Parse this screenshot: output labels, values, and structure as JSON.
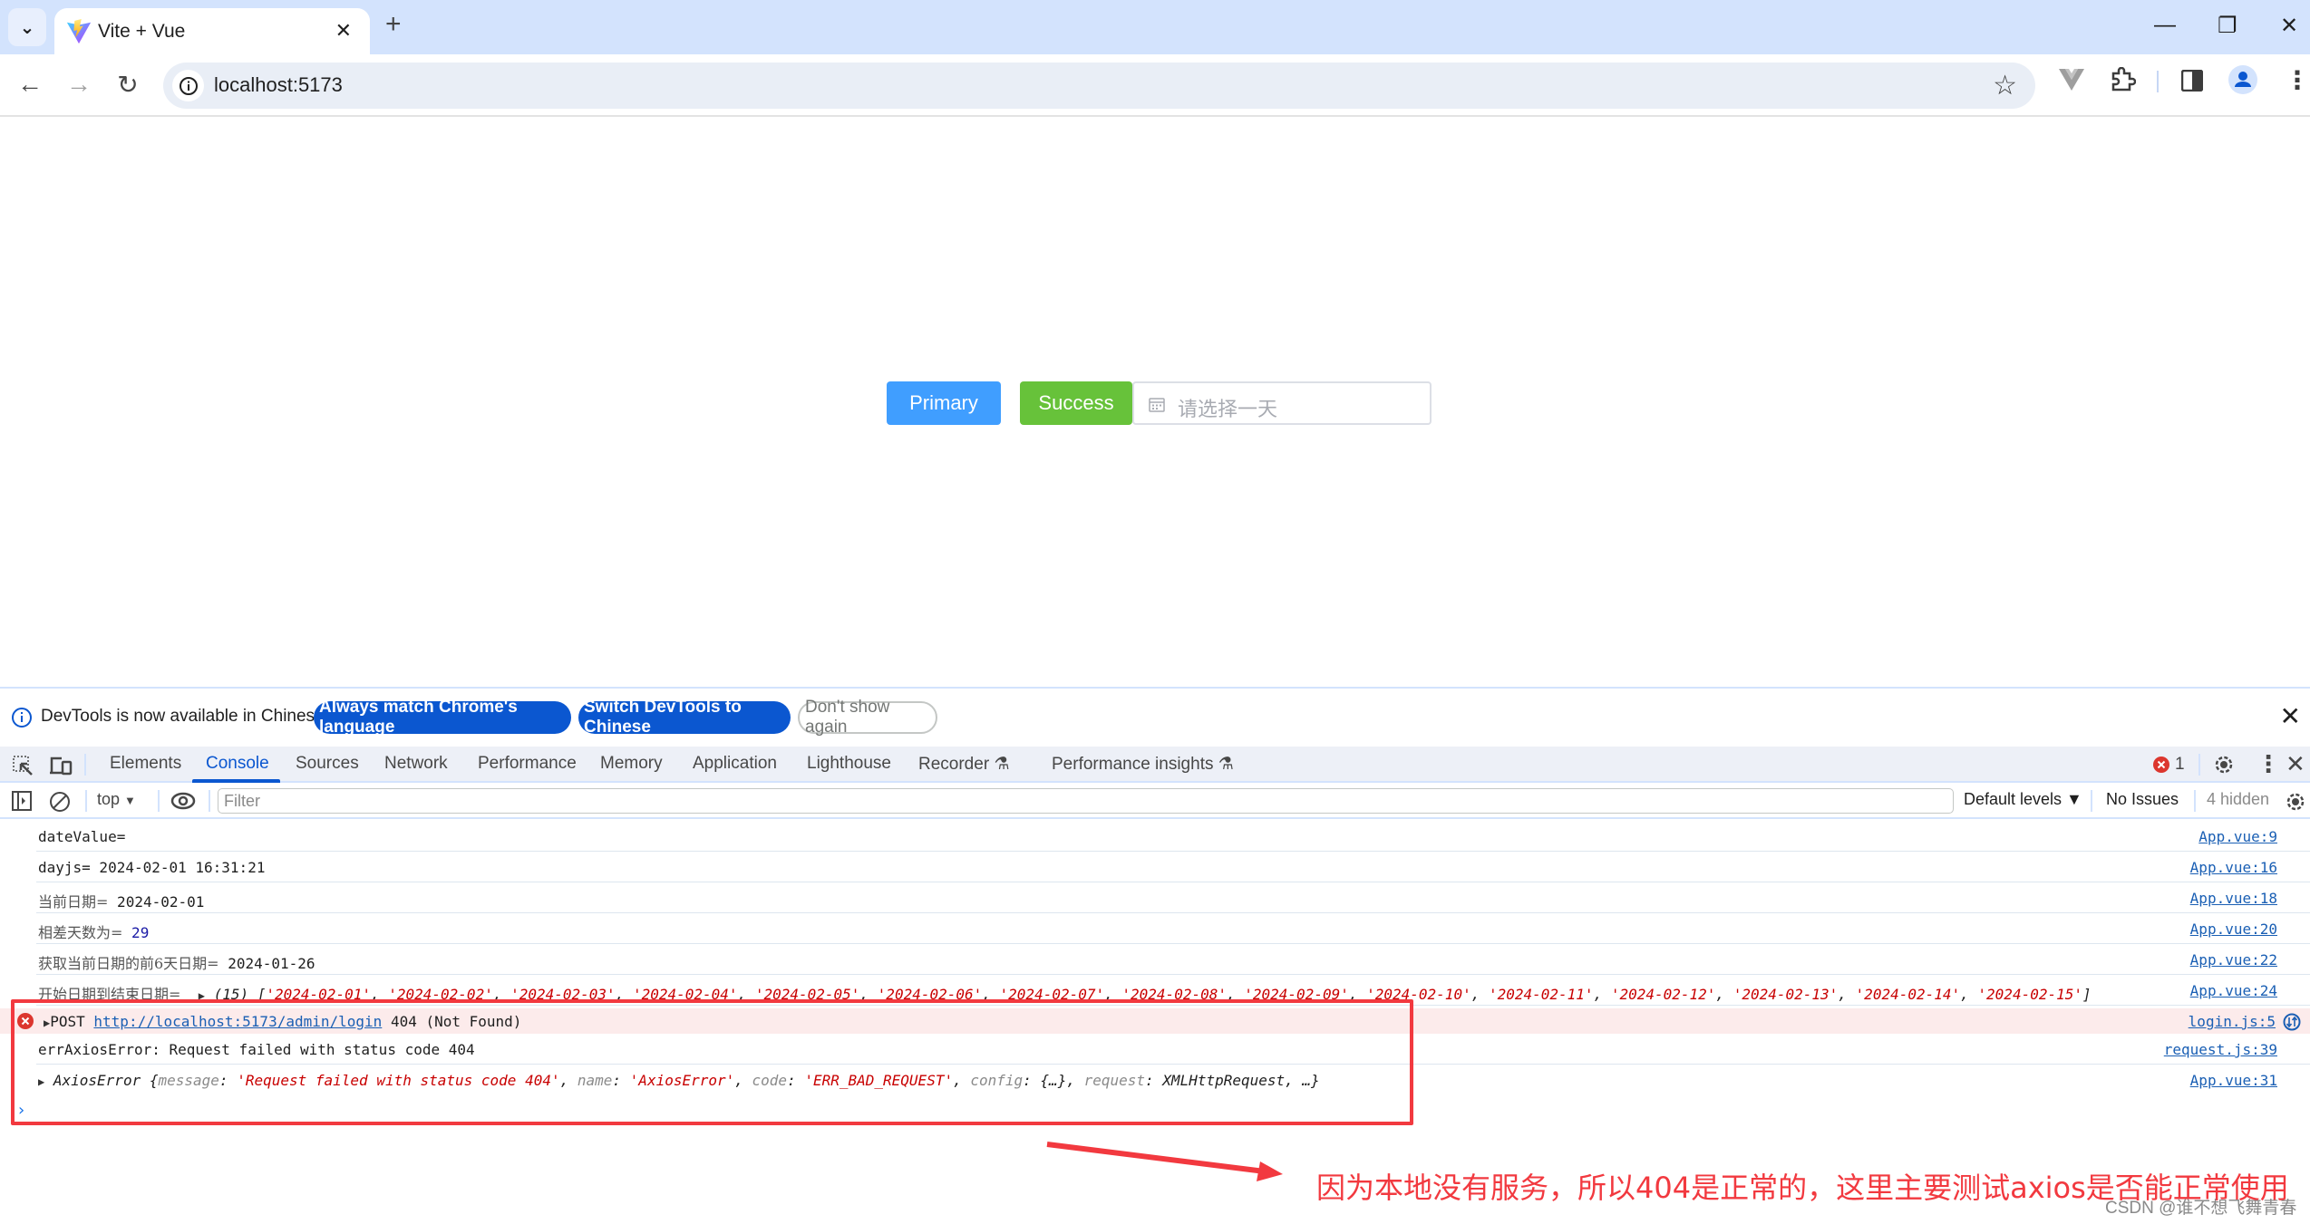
{
  "browser": {
    "tab_title": "Vite + Vue",
    "url": "localhost:5173",
    "icons": {
      "tab_search": "chevron-down-icon",
      "favicon": "vite-logo-icon",
      "close_tab": "close-icon",
      "new_tab": "plus-icon",
      "back": "arrow-left-icon",
      "forward": "arrow-right-icon",
      "reload": "reload-icon",
      "site_info": "info-icon",
      "bookmark": "star-icon",
      "vue_devtools": "vue-logo-icon",
      "extensions": "puzzle-icon",
      "side_panel": "side-panel-icon",
      "profile": "profile-icon",
      "menu": "kebab-menu-icon"
    },
    "glyphs": {
      "tab_search": "⌄",
      "close_tab": "✕",
      "new_tab": "+",
      "back": "←",
      "forward": "→",
      "reload": "↻",
      "bookmark": "☆",
      "minimize": "—",
      "maximize": "❐",
      "close_window": "✕",
      "menu": "⋮"
    }
  },
  "page": {
    "primary_button": "Primary",
    "success_button": "Success",
    "date_placeholder": "请选择一天",
    "colors": {
      "primary": "#409eff",
      "success": "#67c23a"
    }
  },
  "devtools": {
    "infobar": {
      "message": "DevTools is now available in Chinese!",
      "buttons": [
        "Always match Chrome's language",
        "Switch DevTools to Chinese",
        "Don't show again"
      ],
      "close_glyph": "✕"
    },
    "tabs": [
      "Elements",
      "Console",
      "Sources",
      "Network",
      "Performance",
      "Memory",
      "Application",
      "Lighthouse",
      "Recorder",
      "Performance insights"
    ],
    "active_tab": "Console",
    "experimental_glyph": "⚗",
    "error_count": "1",
    "console_toolbar": {
      "context": "top",
      "dropdown_glyph": "▼",
      "filter_placeholder": "Filter",
      "levels": "Default levels ▼",
      "issues": "No Issues",
      "hidden": "4 hidden"
    },
    "messages": [
      {
        "label": "dateValue=",
        "value": "",
        "source": "App.vue:9"
      },
      {
        "label": "dayjs=",
        "value": " 2024-02-01 16:31:21",
        "source": "App.vue:16"
      },
      {
        "label": "当前日期=",
        "value": " 2024-02-01",
        "source": "App.vue:18"
      },
      {
        "label": "相差天数为=",
        "value": " 29",
        "source": "App.vue:20"
      },
      {
        "label": "获取当前日期的前6天日期=",
        "value": " 2024-01-26",
        "source": "App.vue:22"
      },
      {
        "label": "开始日期到结束日期=",
        "array_count": "(15)",
        "array": [
          "2024-02-01",
          "2024-02-02",
          "2024-02-03",
          "2024-02-04",
          "2024-02-05",
          "2024-02-06",
          "2024-02-07",
          "2024-02-08",
          "2024-02-09",
          "2024-02-10",
          "2024-02-11",
          "2024-02-12",
          "2024-02-13",
          "2024-02-14",
          "2024-02-15"
        ],
        "source": "App.vue:24"
      }
    ],
    "error": {
      "method": "POST",
      "url": "http://localhost:5173/admin/login",
      "status": "404 (Not Found)",
      "source": "login.js:5"
    },
    "err_log": {
      "text": "errAxiosError: Request failed with status code 404",
      "source": "request.js:39"
    },
    "axios_obj": {
      "type": "AxiosError",
      "fields": [
        {
          "k": "message",
          "v": "'Request failed with status code 404'",
          "kind": "str"
        },
        {
          "k": "name",
          "v": "'AxiosError'",
          "kind": "str"
        },
        {
          "k": "code",
          "v": "'ERR_BAD_REQUEST'",
          "kind": "str"
        },
        {
          "k": "config",
          "v": "{…}",
          "kind": "plain"
        },
        {
          "k": "request",
          "v": "XMLHttpRequest",
          "kind": "plain"
        }
      ],
      "tail": ", …}",
      "source": "App.vue:31"
    },
    "prompt": "›"
  },
  "annotation": {
    "text": "因为本地没有服务，所以404是正常的，这里主要测试axios是否能正常使用",
    "color": "#f2393f"
  },
  "watermark": "CSDN @谁不想飞舞青春"
}
